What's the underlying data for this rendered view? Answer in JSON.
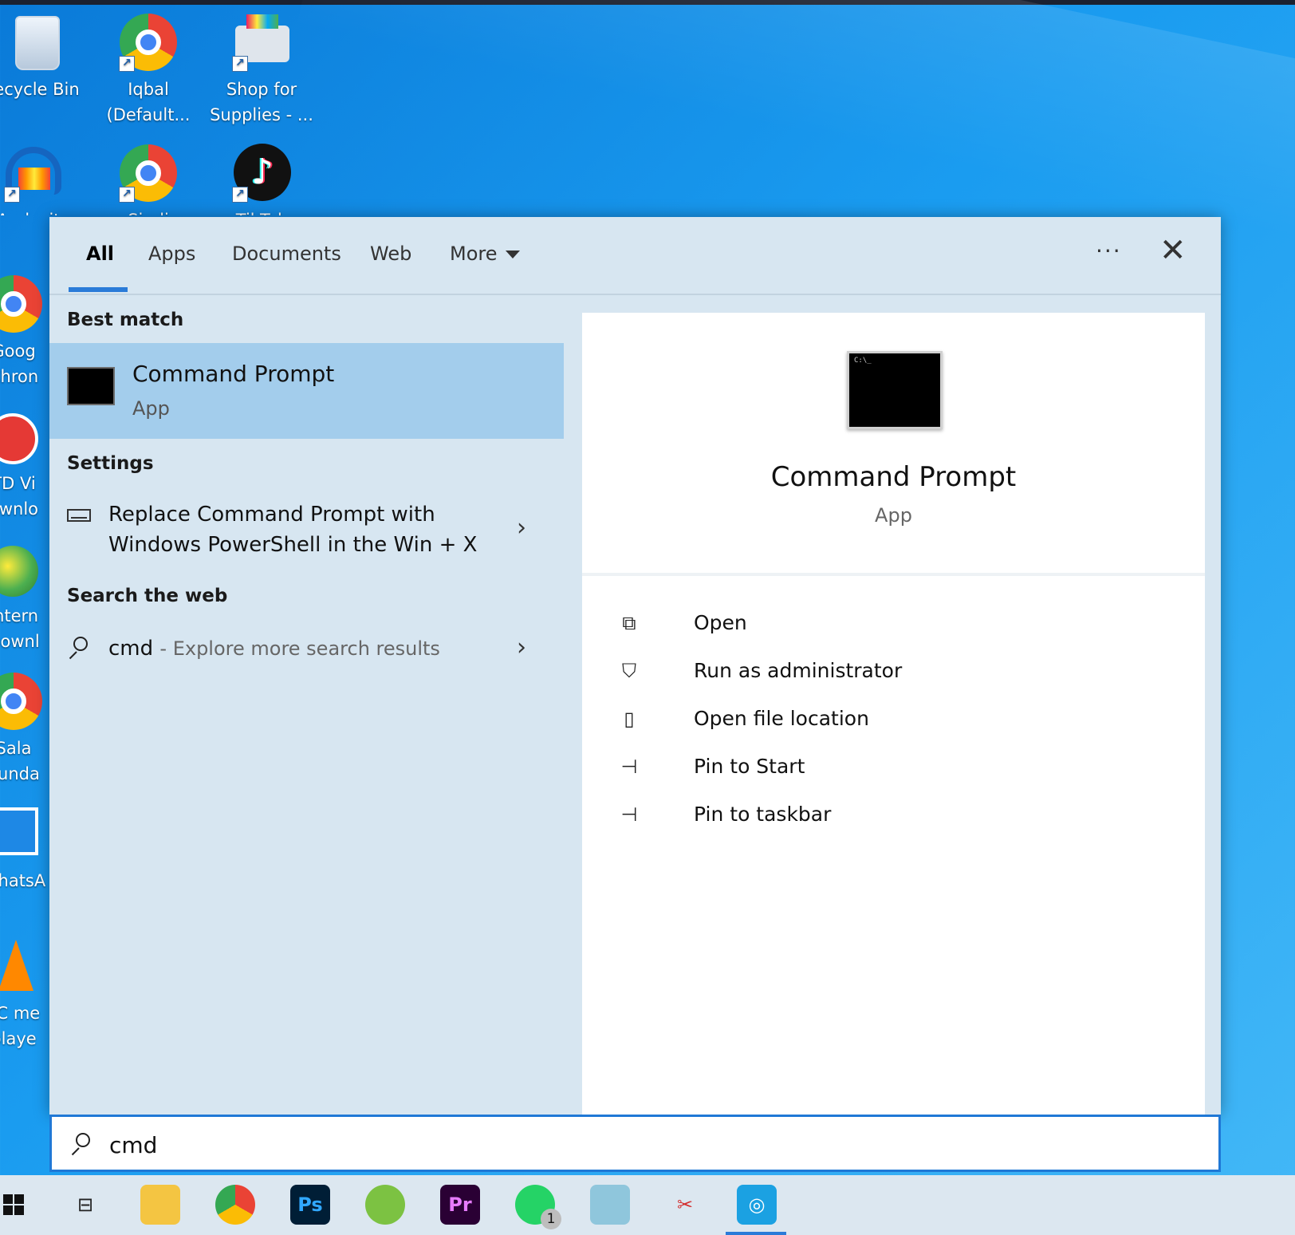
{
  "desktop": {
    "icons": [
      {
        "label": "ecycle Bin",
        "icon": "recycle-bin-icon"
      },
      {
        "label": "Iqbal (Default...",
        "icon": "chrome-profile-icon"
      },
      {
        "label": "Shop for Supplies - ...",
        "icon": "printer-icon"
      },
      {
        "label": "Audacity",
        "icon": "audacity-icon"
      },
      {
        "label": "Sindi",
        "icon": "chrome-profile-icon"
      },
      {
        "label": "TikTok",
        "icon": "tiktok-icon"
      },
      {
        "label": "Goog Chron",
        "icon": "chrome-icon"
      },
      {
        "label": "TD Vi ownlo",
        "icon": "ytd-downloader-icon"
      },
      {
        "label": "Intern Downl",
        "icon": "idm-icon"
      },
      {
        "label": "Sala ounda",
        "icon": "chrome-profile-icon"
      },
      {
        "label": "WhatsA",
        "icon": "whatsapp-desktop-icon"
      },
      {
        "label": "LC me playe",
        "icon": "vlc-icon"
      }
    ]
  },
  "tabs": {
    "all": "All",
    "apps": "Apps",
    "documents": "Documents",
    "web": "Web",
    "more": "More"
  },
  "top_actions": {
    "more_options": "···",
    "close": "✕"
  },
  "results": {
    "best_match_heading": "Best match",
    "best_match": {
      "title": "Command Prompt",
      "subtitle": "App"
    },
    "settings_heading": "Settings",
    "settings_item_line1": "Replace Command Prompt with",
    "settings_item_line2": "Windows PowerShell in the Win + X",
    "web_heading": "Search the web",
    "web_item_query": "cmd",
    "web_item_suffix": "- Explore more search results"
  },
  "preview": {
    "title": "Command Prompt",
    "subtitle": "App",
    "actions": [
      {
        "label": "Open",
        "icon": "open-icon"
      },
      {
        "label": "Run as administrator",
        "icon": "shield-icon"
      },
      {
        "label": "Open file location",
        "icon": "file-location-icon"
      },
      {
        "label": "Pin to Start",
        "icon": "pin-icon"
      },
      {
        "label": "Pin to taskbar",
        "icon": "pin-icon"
      }
    ]
  },
  "search": {
    "value": "cmd"
  },
  "taskbar": {
    "items": [
      {
        "name": "start",
        "icon": "windows-logo-icon"
      },
      {
        "name": "task-view",
        "icon": "task-view-icon"
      },
      {
        "name": "file-explorer",
        "icon": "folder-icon"
      },
      {
        "name": "chrome",
        "icon": "chrome-icon"
      },
      {
        "name": "photoshop",
        "icon": "photoshop-icon",
        "text": "Ps"
      },
      {
        "name": "green-app",
        "icon": "leaf-app-icon"
      },
      {
        "name": "premiere",
        "icon": "premiere-icon",
        "text": "Pr"
      },
      {
        "name": "whatsapp",
        "icon": "whatsapp-icon",
        "badge": "1"
      },
      {
        "name": "notepad",
        "icon": "notepad-icon"
      },
      {
        "name": "snipping",
        "icon": "scissors-icon"
      },
      {
        "name": "camera",
        "icon": "camera-icon"
      }
    ]
  },
  "colors": {
    "accent": "#2a7bd8",
    "selected_row": "#a3cdec",
    "panel": "#d7e6f1"
  }
}
